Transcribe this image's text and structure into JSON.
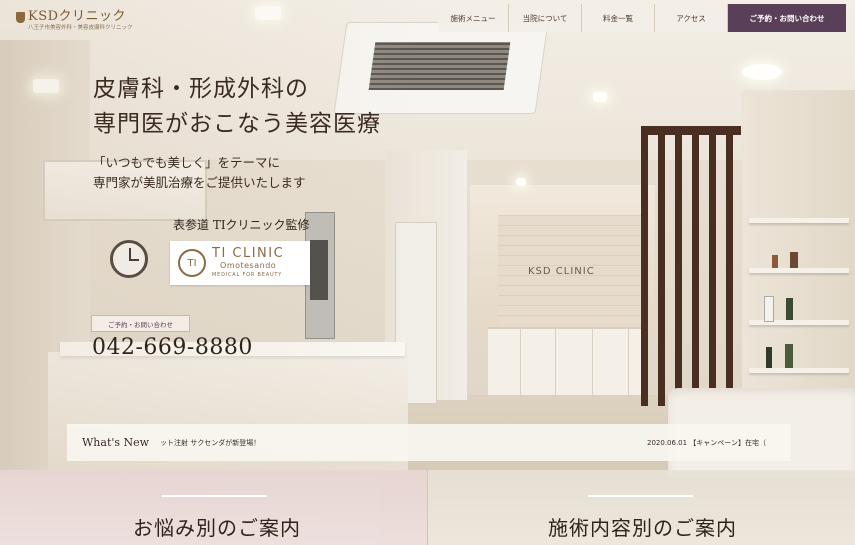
{
  "header": {
    "logo_title": "KSDクリニック",
    "logo_sub": "八王子市美容外科・美容皮膚科クリニック",
    "nav": [
      {
        "label": "施術メニュー"
      },
      {
        "label": "当院について"
      },
      {
        "label": "料金一覧"
      },
      {
        "label": "アクセス"
      },
      {
        "label": "ご予約・お問い合わせ"
      }
    ]
  },
  "hero": {
    "title_line1": "皮膚科・形成外科の",
    "title_line2": "専門医がおこなう美容医療",
    "sub_line1": "「いつもでも美しく」をテーマに",
    "sub_line2": "専門家が美肌治療をご提供いたします",
    "supervision": "表参道 TIクリニック監修",
    "ti_logo": {
      "mark": "TI",
      "name": "TI CLINIC",
      "location": "Omotesando",
      "tagline": "MEDICAL FOR BEAUTY"
    },
    "contact_button": "ご予約・お問い合わせ",
    "phone": "042-669-8880"
  },
  "background_sign": "KSD CLINIC",
  "news": {
    "label": "What's New",
    "item1": "ット注射 サクセンダが新登場！",
    "item2": "2020.06.01 【キャンペーン】在宅（"
  },
  "guides": [
    {
      "title": "お悩み別のご案内"
    },
    {
      "title": "施術内容別のご案内"
    }
  ],
  "colors": {
    "accent": "#5a3f58",
    "text": "#3b2c22",
    "logo": "#8c6a44"
  }
}
